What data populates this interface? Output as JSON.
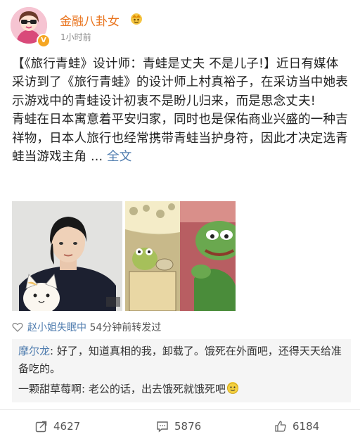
{
  "header": {
    "author": "金融八卦女",
    "time": "1小时前"
  },
  "post": {
    "paragraphs": [
      "【《旅行青蛙》设计师：青蛙是丈夫 不是儿子!】近日有媒体采访到了《旅行青蛙》的设计师上村真裕子，在采访当中她表示游戏中的青蛙设计初衷不是盼儿归来，而是思念丈夫!",
      "青蛙在日本寓意着平安归家，同时也是保佑商业兴盛的一种吉祥物，日本人旅行也经常携带青蛙当护身符，因此才决定选青蛙当游戏主角 ..."
    ],
    "expand": "全文"
  },
  "repost": {
    "name": "赵小姐失眠中",
    "meta": "54分钟前转发过"
  },
  "comments": [
    {
      "name": "摩尔龙",
      "text": ": 好了，知道真相的我，卸载了。饿死在外面吧，还得天天给准备吃的。"
    },
    {
      "name": "一颗甜草莓啊",
      "text": ": 老公的话，出去饿死就饿死吧"
    }
  ],
  "actions": {
    "repost_count": "4627",
    "comment_count": "5876",
    "like_count": "6184"
  },
  "colors": {
    "author": "#e9731c",
    "link": "#507daf",
    "comment_bg": "#f5f5f5"
  },
  "icons": {
    "repost": "repost-icon",
    "comment": "comment-icon",
    "like": "thumbs-up-icon"
  }
}
